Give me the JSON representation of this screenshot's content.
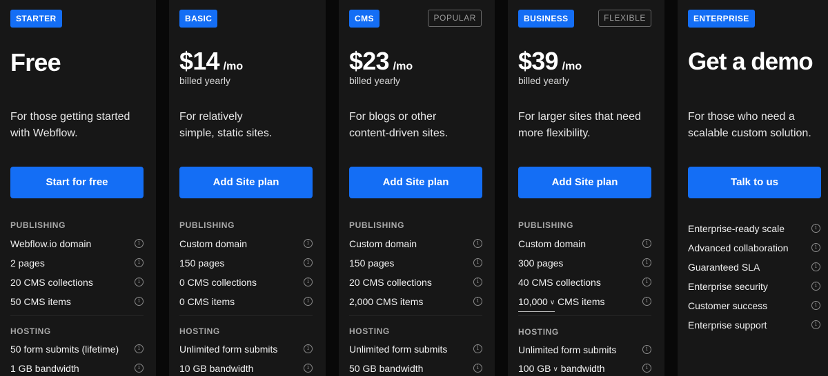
{
  "plans": {
    "starter": {
      "badge": "STARTER",
      "price": "Free",
      "description_line1": "For those getting started",
      "description_line2": "with Webflow.",
      "cta": "Start for free",
      "publishing_title": "PUBLISHING",
      "publishing": [
        "Webflow.io domain",
        "2 pages",
        "20 CMS collections",
        "50 CMS items"
      ],
      "hosting_title": "HOSTING",
      "hosting": [
        "50 form submits (lifetime)",
        "1 GB bandwidth"
      ]
    },
    "basic": {
      "badge": "BASIC",
      "price": "$14",
      "per": "/mo",
      "billing": "billed yearly",
      "description_line1": "For relatively",
      "description_line2": "simple, static sites.",
      "cta": "Add Site plan",
      "publishing_title": "PUBLISHING",
      "publishing": [
        "Custom domain",
        "150 pages",
        "0 CMS collections",
        "0 CMS items"
      ],
      "hosting_title": "HOSTING",
      "hosting": [
        "Unlimited form submits",
        "10 GB bandwidth"
      ]
    },
    "cms": {
      "badge": "CMS",
      "tag": "POPULAR",
      "price": "$23",
      "per": "/mo",
      "billing": "billed yearly",
      "description_line1": "For blogs or other",
      "description_line2": "content-driven sites.",
      "cta": "Add Site plan",
      "publishing_title": "PUBLISHING",
      "publishing": [
        "Custom domain",
        "150 pages",
        "20 CMS collections",
        "2,000 CMS items"
      ],
      "hosting_title": "HOSTING",
      "hosting": [
        "Unlimited form submits",
        "50 GB bandwidth"
      ]
    },
    "business": {
      "badge": "BUSINESS",
      "tag": "FLEXIBLE",
      "price": "$39",
      "per": "/mo",
      "billing": "billed yearly",
      "description_line1": "For larger sites that need",
      "description_line2": "more flexibility.",
      "cta": "Add Site plan",
      "publishing_title": "PUBLISHING",
      "publishing": [
        "Custom domain",
        "300 pages",
        "40 CMS collections"
      ],
      "cms_items_select": "10,000",
      "cms_items_suffix": "CMS items",
      "hosting_title": "HOSTING",
      "hosting": [
        "Unlimited form submits"
      ],
      "bandwidth_select": "100 GB",
      "bandwidth_suffix": "bandwidth"
    },
    "enterprise": {
      "badge": "ENTERPRISE",
      "price": "Get a demo",
      "description_line1": "For those who need a",
      "description_line2": "scalable custom solution.",
      "cta": "Talk to us",
      "features": [
        "Enterprise-ready scale",
        "Advanced collaboration",
        "Guaranteed SLA",
        "Enterprise security",
        "Customer success",
        "Enterprise support"
      ]
    }
  },
  "info_glyph": "i",
  "chevron_glyph": "∨",
  "colors": {
    "accent": "#146ef5",
    "card": "#171717",
    "background": "#080808"
  }
}
